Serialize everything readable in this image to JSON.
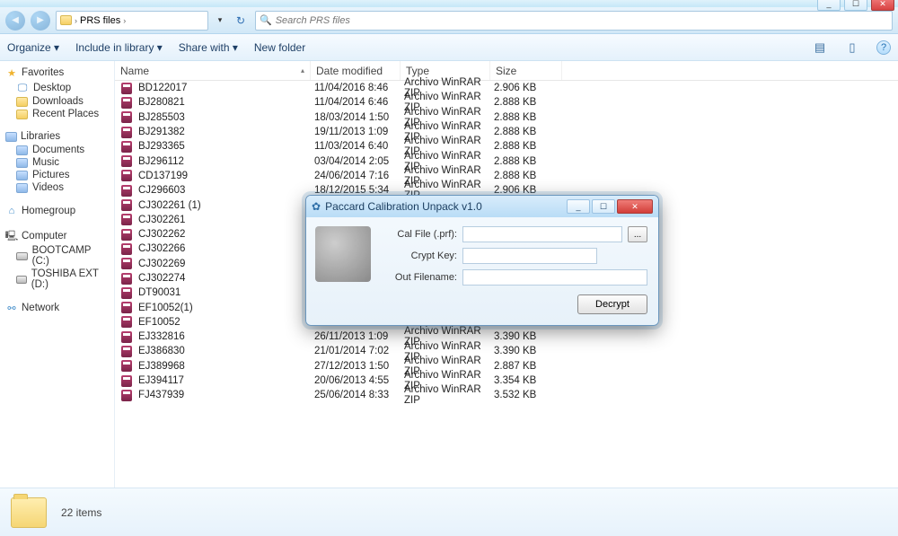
{
  "window": {
    "min": "_",
    "max": "☐",
    "close": "✕"
  },
  "address": {
    "crumb1": "PRS files",
    "sep": "›",
    "search_placeholder": "Search PRS files"
  },
  "toolbar": {
    "organize": "Organize ▾",
    "include": "Include in library ▾",
    "share": "Share with ▾",
    "newfolder": "New folder"
  },
  "sidebar": {
    "favorites": "Favorites",
    "desktop": "Desktop",
    "downloads": "Downloads",
    "recent": "Recent Places",
    "libraries": "Libraries",
    "documents": "Documents",
    "music": "Music",
    "pictures": "Pictures",
    "videos": "Videos",
    "homegroup": "Homegroup",
    "computer": "Computer",
    "bootcamp": "BOOTCAMP (C:)",
    "toshiba": "TOSHIBA EXT (D:)",
    "network": "Network"
  },
  "columns": {
    "name": "Name",
    "date": "Date modified",
    "type": "Type",
    "size": "Size"
  },
  "files": [
    {
      "n": "BD122017",
      "d": "11/04/2016 8:46",
      "t": "Archivo WinRAR ZIP",
      "s": "2.906 KB"
    },
    {
      "n": "BJ280821",
      "d": "11/04/2014 6:46",
      "t": "Archivo WinRAR ZIP",
      "s": "2.888 KB"
    },
    {
      "n": "BJ285503",
      "d": "18/03/2014 1:50",
      "t": "Archivo WinRAR ZIP",
      "s": "2.888 KB"
    },
    {
      "n": "BJ291382",
      "d": "19/11/2013 1:09",
      "t": "Archivo WinRAR ZIP",
      "s": "2.888 KB"
    },
    {
      "n": "BJ293365",
      "d": "11/03/2014 6:40",
      "t": "Archivo WinRAR ZIP",
      "s": "2.888 KB"
    },
    {
      "n": "BJ296112",
      "d": "03/04/2014 2:05",
      "t": "Archivo WinRAR ZIP",
      "s": "2.888 KB"
    },
    {
      "n": "CD137199",
      "d": "24/06/2014 7:16",
      "t": "Archivo WinRAR ZIP",
      "s": "2.888 KB"
    },
    {
      "n": "CJ296603",
      "d": "18/12/2015 5:34",
      "t": "Archivo WinRAR ZIP",
      "s": "2.906 KB"
    },
    {
      "n": "CJ302261 (1)",
      "d": "",
      "t": "",
      "s": ""
    },
    {
      "n": "CJ302261",
      "d": "",
      "t": "",
      "s": ""
    },
    {
      "n": "CJ302262",
      "d": "",
      "t": "",
      "s": ""
    },
    {
      "n": "CJ302266",
      "d": "",
      "t": "",
      "s": ""
    },
    {
      "n": "CJ302269",
      "d": "",
      "t": "",
      "s": ""
    },
    {
      "n": "CJ302274",
      "d": "",
      "t": "",
      "s": ""
    },
    {
      "n": "DT90031",
      "d": "",
      "t": "",
      "s": ""
    },
    {
      "n": "EF10052(1)",
      "d": "",
      "t": "",
      "s": ""
    },
    {
      "n": "EF10052",
      "d": "",
      "t": "",
      "s": ""
    },
    {
      "n": "EJ332816",
      "d": "26/11/2013 1:09",
      "t": "Archivo WinRAR ZIP",
      "s": "3.390 KB"
    },
    {
      "n": "EJ386830",
      "d": "21/01/2014 7:02",
      "t": "Archivo WinRAR ZIP",
      "s": "3.390 KB"
    },
    {
      "n": "EJ389968",
      "d": "27/12/2013 1:50",
      "t": "Archivo WinRAR ZIP",
      "s": "2.887 KB"
    },
    {
      "n": "EJ394117",
      "d": "20/06/2013 4:55",
      "t": "Archivo WinRAR ZIP",
      "s": "3.354 KB"
    },
    {
      "n": "FJ437939",
      "d": "25/06/2014 8:33",
      "t": "Archivo WinRAR ZIP",
      "s": "3.532 KB"
    }
  ],
  "status": {
    "count": "22 items"
  },
  "dialog": {
    "title": "Paccard Calibration Unpack v1.0",
    "calfile_label": "Cal File (.prf):",
    "cryptkey_label": "Crypt Key:",
    "outfile_label": "Out Filename:",
    "browse": "...",
    "decrypt": "Decrypt",
    "min": "_",
    "max": "☐",
    "close": "✕"
  }
}
